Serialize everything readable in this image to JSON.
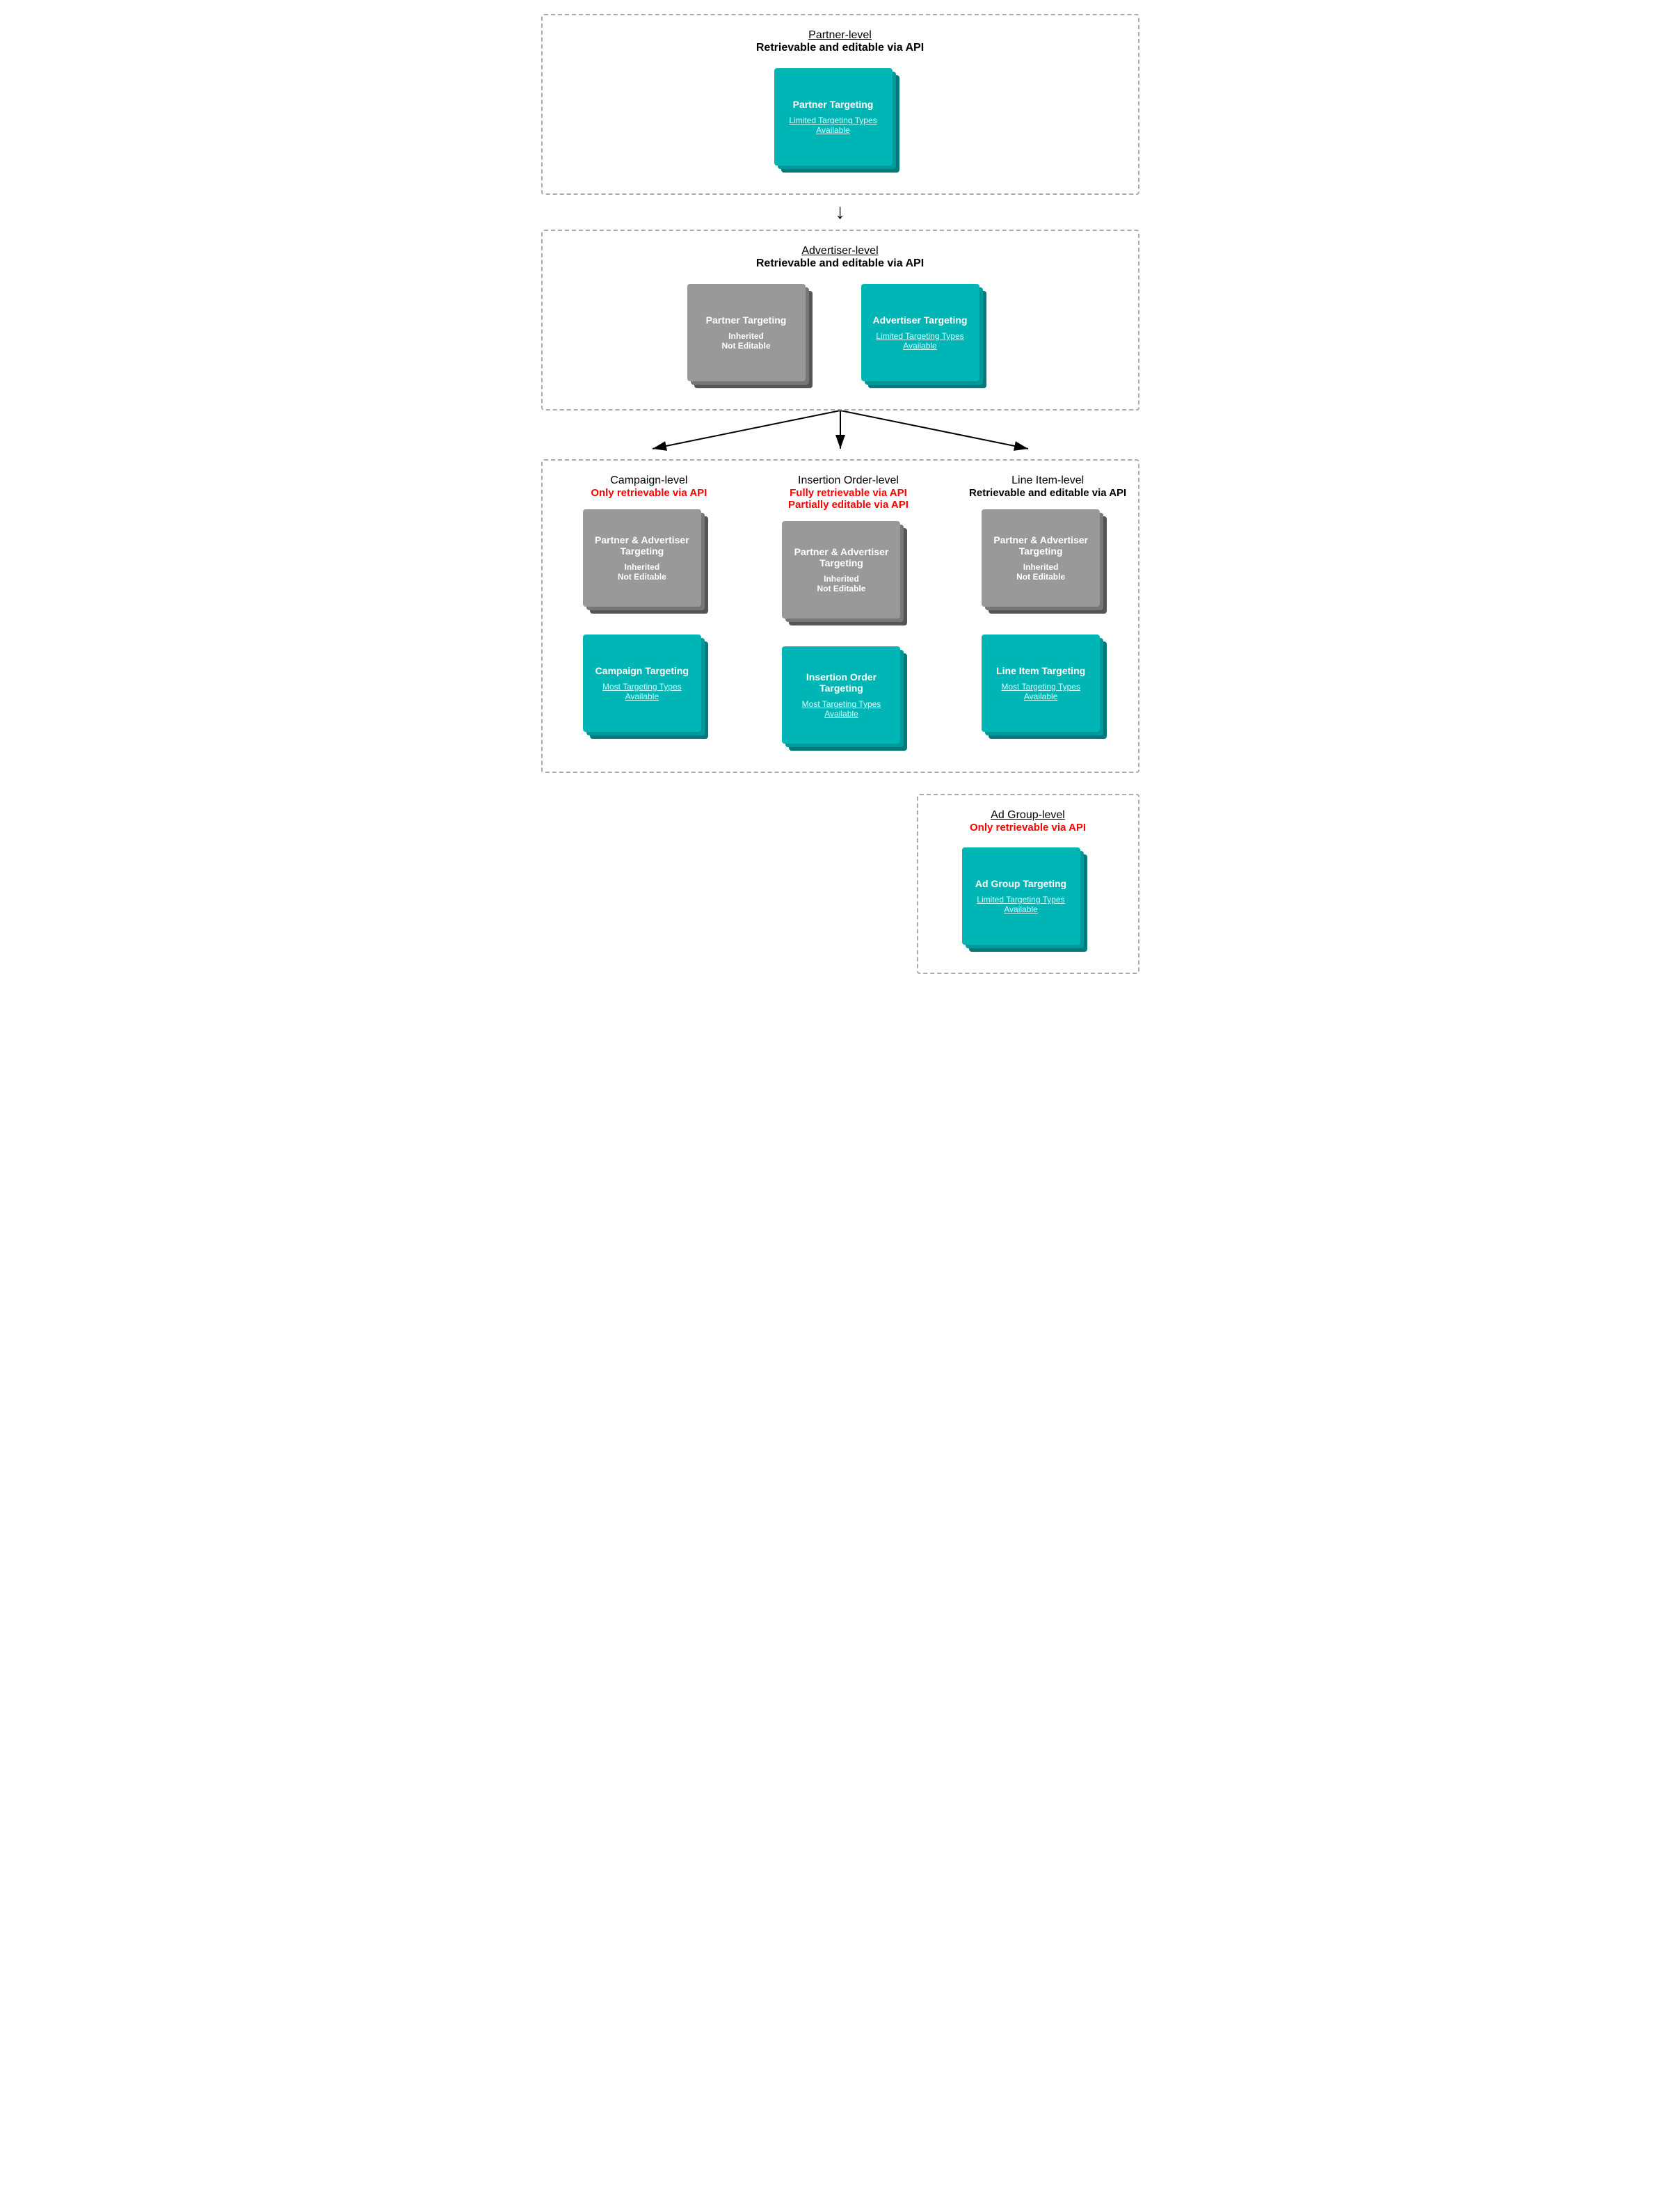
{
  "partner_level": {
    "name": "Partner-level",
    "desc": "Retrievable and editable via API",
    "card": {
      "title": "Partner Targeting",
      "link": "Limited Targeting Types Available"
    }
  },
  "advertiser_level": {
    "name": "Advertiser-level",
    "desc": "Retrievable and editable via API",
    "card_gray": {
      "title": "Partner Targeting",
      "sub1": "Inherited",
      "sub2": "Not Editable"
    },
    "card_teal": {
      "title": "Advertiser Targeting",
      "link": "Limited Targeting Types Available"
    }
  },
  "campaign_level": {
    "name": "Campaign-level",
    "desc_red": "Only retrievable via API",
    "card_gray": {
      "title": "Partner & Advertiser Targeting",
      "sub1": "Inherited",
      "sub2": "Not Editable"
    },
    "card_teal": {
      "title": "Campaign Targeting",
      "link": "Most Targeting Types Available"
    }
  },
  "io_level": {
    "name": "Insertion Order-level",
    "desc_red1": "Fully retrievable via API",
    "desc_red2": "Partially editable via API",
    "card_gray": {
      "title": "Partner & Advertiser Targeting",
      "sub1": "Inherited",
      "sub2": "Not Editable"
    },
    "card_teal": {
      "title": "Insertion Order Targeting",
      "link": "Most Targeting Types Available"
    }
  },
  "li_level": {
    "name": "Line Item-level",
    "desc": "Retrievable and editable via API",
    "card_gray": {
      "title": "Partner & Advertiser Targeting",
      "sub1": "Inherited",
      "sub2": "Not Editable"
    },
    "card_teal": {
      "title": "Line Item Targeting",
      "link": "Most Targeting Types Available"
    }
  },
  "adgroup_level": {
    "name": "Ad Group-level",
    "desc_red": "Only retrievable via API",
    "card_teal": {
      "title": "Ad Group Targeting",
      "link": "Limited Targeting Types Available"
    }
  }
}
